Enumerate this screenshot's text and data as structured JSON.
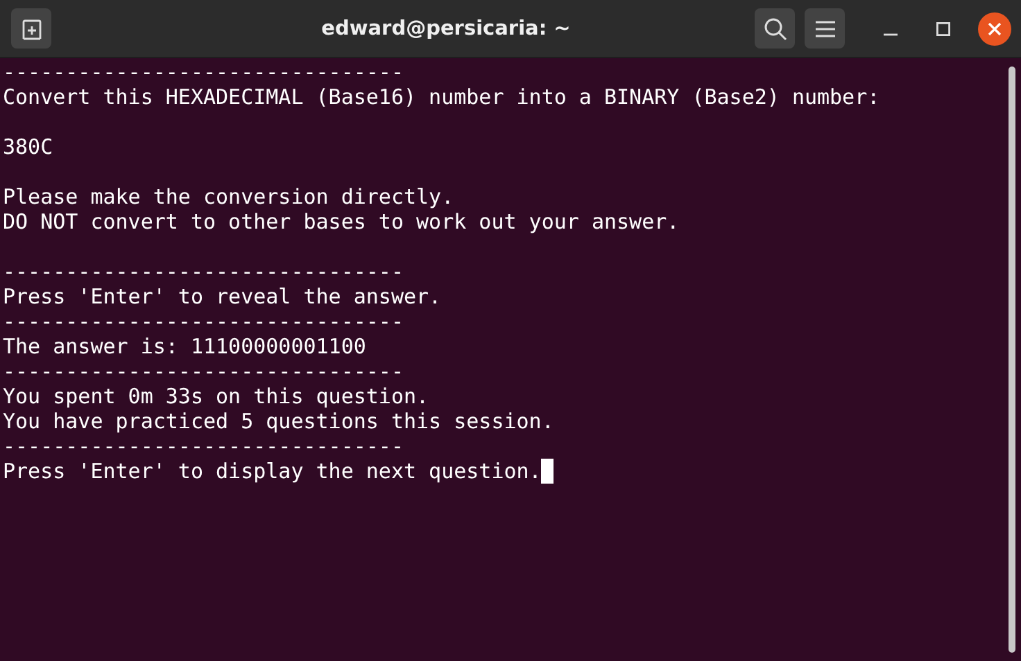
{
  "window": {
    "title": "edward@persicaria: ~"
  },
  "terminal": {
    "lines": [
      {
        "kind": "text",
        "text": "--------------------------------"
      },
      {
        "kind": "text",
        "text": "Convert this HEXADECIMAL (Base16) number into a BINARY (Base2) number:"
      },
      {
        "kind": "blank"
      },
      {
        "kind": "text",
        "text": "380C"
      },
      {
        "kind": "blank"
      },
      {
        "kind": "text",
        "text": "Please make the conversion directly."
      },
      {
        "kind": "text",
        "text": "DO NOT convert to other bases to work out your answer."
      },
      {
        "kind": "blank"
      },
      {
        "kind": "text",
        "text": "--------------------------------"
      },
      {
        "kind": "text",
        "text": "Press 'Enter' to reveal the answer."
      },
      {
        "kind": "text",
        "text": "--------------------------------"
      },
      {
        "kind": "text",
        "text": "The answer is: 11100000001100"
      },
      {
        "kind": "text",
        "text": "--------------------------------"
      },
      {
        "kind": "text",
        "text": "You spent 0m 33s on this question."
      },
      {
        "kind": "text",
        "text": "You have practiced 5 questions this session."
      },
      {
        "kind": "text",
        "text": "--------------------------------"
      },
      {
        "kind": "text",
        "text": "Press 'Enter' to display the next question.",
        "cursor": true
      }
    ]
  }
}
